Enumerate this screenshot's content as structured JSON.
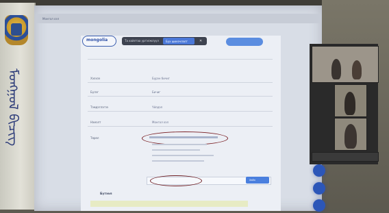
{
  "browser": {
    "tab_label": "Монгол хэл"
  },
  "page": {
    "logo_text": "mongolia",
    "toast_text": "Та хайлтаа үргэлжлүүл",
    "toast_button": "Бүх шинэчлэлт",
    "form": {
      "rows": [
        {
          "label": "Хэлхээ",
          "value": "Бүрэн бичиг"
        },
        {
          "label": "Бүлэг",
          "value": "Бичиг"
        },
        {
          "label": "Тэмдэглэгээ",
          "value": "Үйлдэл"
        },
        {
          "label": "Нэмэлт",
          "value": "Монгол хэл"
        },
        {
          "label": "Төрөл",
          "value": ""
        }
      ],
      "search_button": "Хайх"
    },
    "section_title": "Бүтээл"
  },
  "video_tiles": [
    {
      "name": ""
    },
    {
      "name": ""
    },
    {
      "name": ""
    },
    {
      "name": ""
    }
  ],
  "colors": {
    "accent_blue": "#2c56b8",
    "highlight_ellipse": "#7a1f24"
  }
}
